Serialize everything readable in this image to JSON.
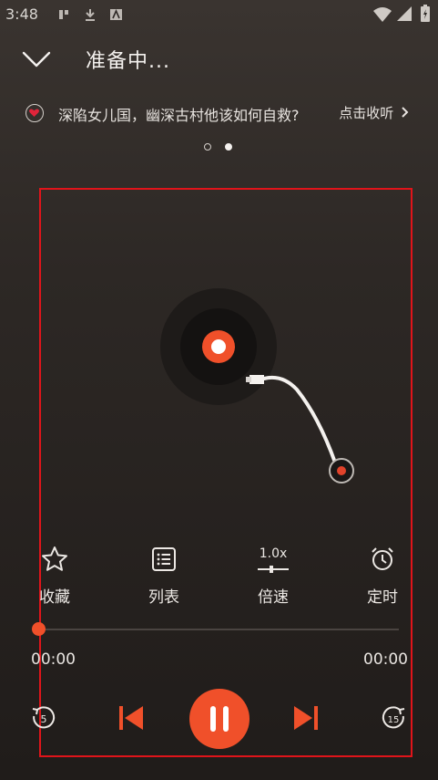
{
  "status_bar": {
    "time": "3:48"
  },
  "header": {
    "title": "准备中..."
  },
  "banner": {
    "text": "深陷女儿国，幽深古村他该如何自救?",
    "link": "点击收听"
  },
  "pager": {
    "count": 2,
    "active": 2
  },
  "controls": [
    {
      "label": "收藏",
      "icon": "star-icon"
    },
    {
      "label": "列表",
      "icon": "list-icon"
    },
    {
      "label": "倍速",
      "icon": "speed-icon",
      "value": "1.0x"
    },
    {
      "label": "定时",
      "icon": "alarm-clock-icon"
    }
  ],
  "progress": {
    "current": "00:00",
    "total": "00:00",
    "fraction": 0
  },
  "transport": {
    "rewind_seconds": "5",
    "forward_seconds": "15"
  },
  "colors": {
    "accent": "#f0502a",
    "highlight": "#e0141a"
  }
}
